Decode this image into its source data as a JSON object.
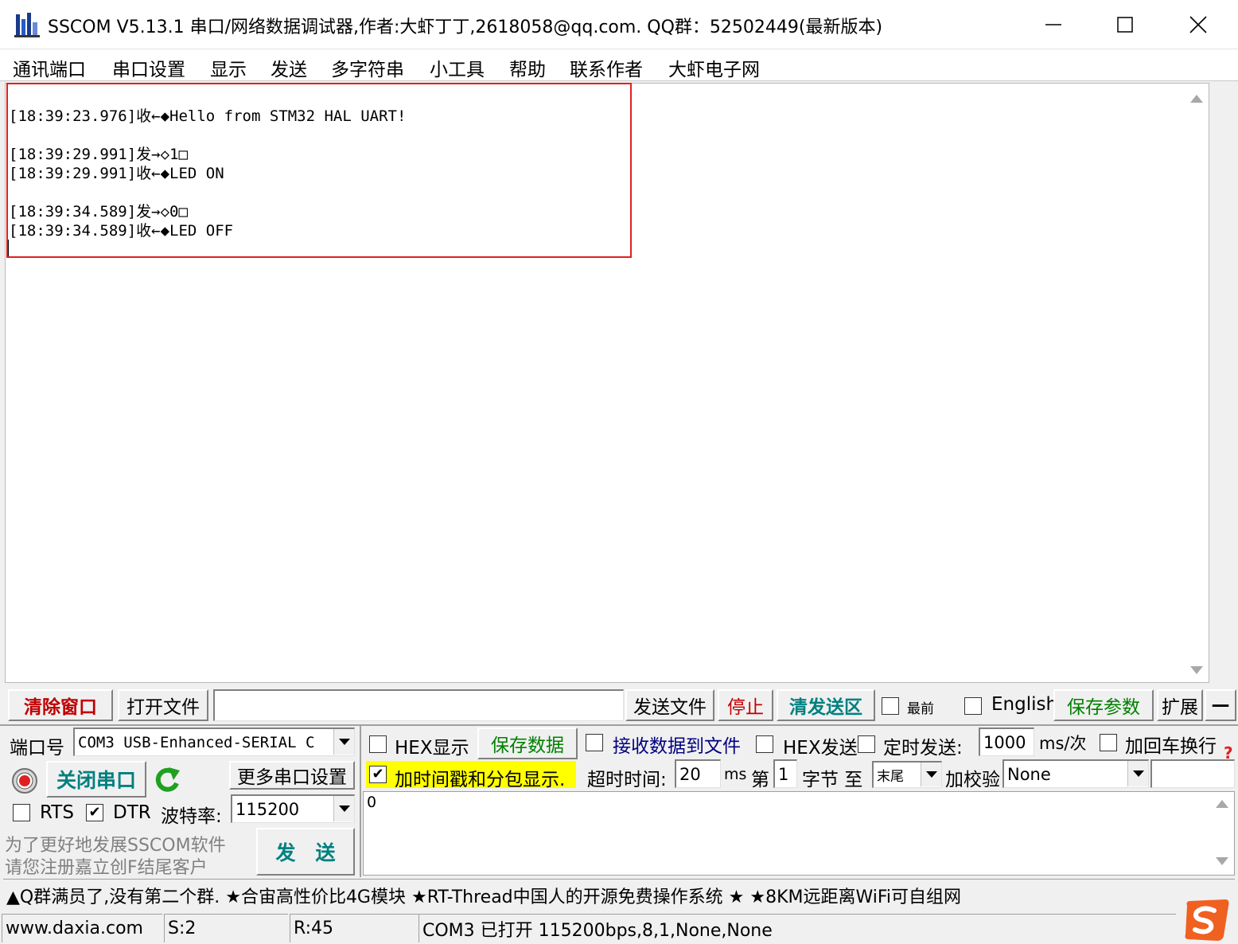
{
  "window": {
    "title": "SSCOM V5.13.1 串口/网络数据调试器,作者:大虾丁丁,2618058@qq.com. QQ群：52502449(最新版本)"
  },
  "menu": {
    "items": [
      "通讯端口",
      "串口设置",
      "显示",
      "发送",
      "多字符串",
      "小工具",
      "帮助",
      "联系作者",
      "大虾电子网"
    ]
  },
  "receive": {
    "lines": [
      "[18:39:23.976]收←◆Hello from STM32 HAL UART!",
      "[18:39:29.991]发→◇1□",
      "[18:39:29.991]收←◆LED ON",
      "[18:39:34.589]发→◇0□",
      "[18:39:34.589]收←◆LED OFF"
    ]
  },
  "toolbar": {
    "clear_window": "清除窗口",
    "open_file": "打开文件",
    "file_path": "",
    "send_file": "发送文件",
    "stop": "停止",
    "clear_send": "清发送区",
    "topmost": "最前",
    "english": "English",
    "save_params": "保存参数",
    "expand": "扩展",
    "collapse": "—"
  },
  "port": {
    "port_label": "端口号",
    "port_value": "COM3 USB-Enhanced-SERIAL C",
    "close_port": "关闭串口",
    "more_settings": "更多串口设置",
    "rts": "RTS",
    "dtr": "DTR",
    "rts_checked": false,
    "dtr_checked": true,
    "baud_label": "波特率:",
    "baud_value": "115200",
    "promo_line1": "为了更好地发展SSCOM软件",
    "promo_line2": "请您注册嘉立创F结尾客户",
    "send": "发　送"
  },
  "options": {
    "hex_display": "HEX显示",
    "save_data": "保存数据",
    "recv_to_file": "接收数据到文件",
    "hex_send": "HEX发送",
    "timed_send": "定时发送:",
    "interval": "1000",
    "interval_unit": "ms/次",
    "add_crlf": "加回车换行",
    "timestamp": "加时间戳和分包显示.",
    "timestamp_checked": true,
    "timeout_label": "超时时间:",
    "timeout_value": "20",
    "timeout_unit": "ms",
    "nth_label": "第",
    "nth_value": "1",
    "byte_to": "字节 至",
    "end_value": "末尾",
    "checksum_label": "加校验",
    "checksum_value": "None"
  },
  "send_area": {
    "text": "0"
  },
  "ticker": {
    "text": "▲Q群满员了,没有第二个群. ★合宙高性价比4G模块 ★RT-Thread中国人的开源免费操作系统 ★ ★8KM远距离WiFi可自组网"
  },
  "status": {
    "website": "www.daxia.com",
    "sent": "S:2",
    "received": "R:45",
    "port_status": "COM3 已打开  115200bps,8,1,None,None"
  },
  "colors": {
    "log_highlight": "#e02020",
    "clear_window_text": "#c00000",
    "green_text": "#008000",
    "blue_text": "#000080",
    "timestamp_bg": "#ffff00",
    "ime_logo": "#f06020"
  }
}
